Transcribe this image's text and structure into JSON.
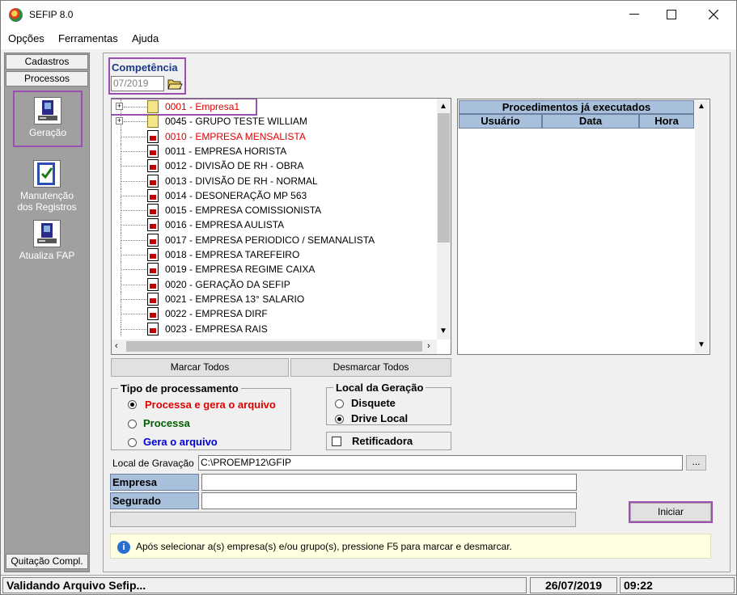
{
  "window": {
    "title": "SEFIP 8.0",
    "minimize": "—",
    "maximize": "☐",
    "close": "✕"
  },
  "menu": [
    "Opções",
    "Ferramentas",
    "Ajuda"
  ],
  "left_panel": {
    "tabs": [
      "Cadastros",
      "Processos"
    ],
    "launchers": [
      {
        "label": "Geração",
        "icon": "computer-disk-icon"
      },
      {
        "label1": "Manutenção",
        "label2": "dos Registros",
        "icon": "checklist-icon"
      },
      {
        "label": "Atualiza FAP",
        "icon": "computer-disk-icon"
      }
    ],
    "bottom_tab": "Quitação Compl."
  },
  "competencia": {
    "label": "Competência",
    "value": "07/2019"
  },
  "tree": {
    "items": [
      {
        "text": "0001 - Empresa1",
        "type": "folder",
        "expandable": true,
        "color": "#e00000"
      },
      {
        "text": "0045 - GRUPO TESTE WILLIAM",
        "type": "folder",
        "expandable": true,
        "color": "#000000"
      },
      {
        "text": "0010 - EMPRESA MENSALISTA",
        "type": "doc",
        "color": "#e00000"
      },
      {
        "text": "0011 - EMPRESA HORISTA",
        "type": "doc",
        "color": "#000000"
      },
      {
        "text": "0012 - DIVISÃO DE RH - OBRA",
        "type": "doc",
        "color": "#000000"
      },
      {
        "text": "0013 - DIVISÃO DE RH - NORMAL",
        "type": "doc",
        "color": "#000000"
      },
      {
        "text": "0014 - DESONERAÇÃO MP 563",
        "type": "doc",
        "color": "#000000"
      },
      {
        "text": "0015 - EMPRESA COMISSIONISTA",
        "type": "doc",
        "color": "#000000"
      },
      {
        "text": "0016 - EMPRESA AULISTA",
        "type": "doc",
        "color": "#000000"
      },
      {
        "text": "0017 - EMPRESA PERIODICO / SEMANALISTA",
        "type": "doc",
        "color": "#000000"
      },
      {
        "text": "0018 - EMPRESA TAREFEIRO",
        "type": "doc",
        "color": "#000000"
      },
      {
        "text": "0019 - EMPRESA REGIME CAIXA",
        "type": "doc",
        "color": "#000000"
      },
      {
        "text": "0020 - GERAÇÃO DA SEFIP",
        "type": "doc",
        "color": "#000000"
      },
      {
        "text": "0021 - EMPRESA 13° SALARIO",
        "type": "doc",
        "color": "#000000"
      },
      {
        "text": "0022 - EMPRESA DIRF",
        "type": "doc",
        "color": "#000000"
      },
      {
        "text": "0023 - EMPRESA RAIS",
        "type": "doc",
        "color": "#000000"
      }
    ]
  },
  "procedures": {
    "title": "Procedimentos já executados",
    "columns": [
      "Usuário",
      "Data",
      "Hora"
    ]
  },
  "buttons": {
    "mark_all": "Marcar Todos",
    "unmark_all": "Desmarcar Todos",
    "browse": "...",
    "start": "Iniciar"
  },
  "processing": {
    "title": "Tipo de processamento",
    "options": [
      {
        "label": "Processa e gera o arquivo",
        "color": "#e00000",
        "checked": true
      },
      {
        "label": "Processa",
        "color": "#006000",
        "checked": false
      },
      {
        "label": "Gera o arquivo",
        "color": "#0000d0",
        "checked": false
      }
    ]
  },
  "generation_location": {
    "title": "Local da Geração",
    "options": [
      {
        "label": "Disquete",
        "checked": false
      },
      {
        "label": "Drive Local",
        "checked": true
      }
    ]
  },
  "retificadora": {
    "label": "Retificadora",
    "checked": false
  },
  "local_gravacao": {
    "label": "Local de Gravação",
    "value": "C:\\PROEMP12\\GFIP"
  },
  "fields": {
    "empresa": "Empresa",
    "segurado": "Segurado"
  },
  "info": {
    "text": "Após selecionar a(s) empresa(s) e/ou grupo(s), pressione F5 para marcar e desmarcar."
  },
  "status": {
    "message": "Validando Arquivo Sefip...",
    "date": "26/07/2019",
    "time": "09:22"
  }
}
